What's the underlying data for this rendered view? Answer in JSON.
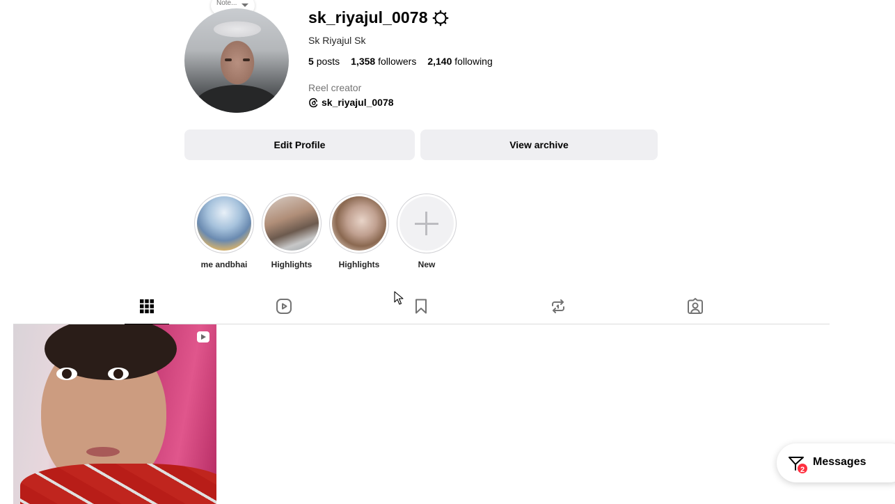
{
  "profile": {
    "username": "sk_riyajul_0078",
    "full_name": "Sk Riyajul Sk",
    "posts_count": "5",
    "posts_label": "posts",
    "followers_count": "1,358",
    "followers_label": "followers",
    "following_count": "2,140",
    "following_label": "following",
    "category": "Reel creator",
    "threads_handle": "sk_riyajul_0078",
    "note_text": "Note..."
  },
  "actions": {
    "edit_profile": "Edit Profile",
    "view_archive": "View archive"
  },
  "highlights": [
    {
      "label": "me andbhai"
    },
    {
      "label": "Highlights"
    },
    {
      "label": "Highlights"
    },
    {
      "label": "New"
    }
  ],
  "tabs": [
    {
      "name": "posts-grid",
      "icon": "grid-icon",
      "active": true
    },
    {
      "name": "reels",
      "icon": "reels-icon",
      "active": false
    },
    {
      "name": "saved",
      "icon": "bookmark-icon",
      "active": false
    },
    {
      "name": "reposts",
      "icon": "repost-icon",
      "active": false
    },
    {
      "name": "tagged",
      "icon": "tagged-user-icon",
      "active": false
    }
  ],
  "messages": {
    "label": "Messages",
    "unread_count": "2"
  }
}
